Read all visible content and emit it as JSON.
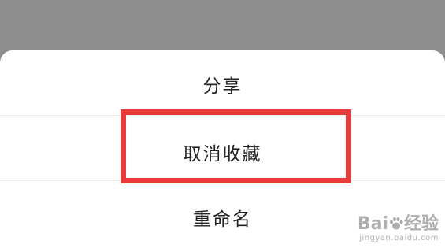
{
  "action_sheet": {
    "items": [
      {
        "label": "分享"
      },
      {
        "label": "取消收藏"
      },
      {
        "label": "重命名"
      }
    ]
  },
  "annotation": {
    "highlight_color": "#e83c3c",
    "highlighted_item": "取消收藏"
  },
  "watermark": {
    "brand_left": "Bai",
    "brand_right": "经验",
    "url": "jingyan.baidu.com",
    "icon": "baidu-paw-icon"
  }
}
